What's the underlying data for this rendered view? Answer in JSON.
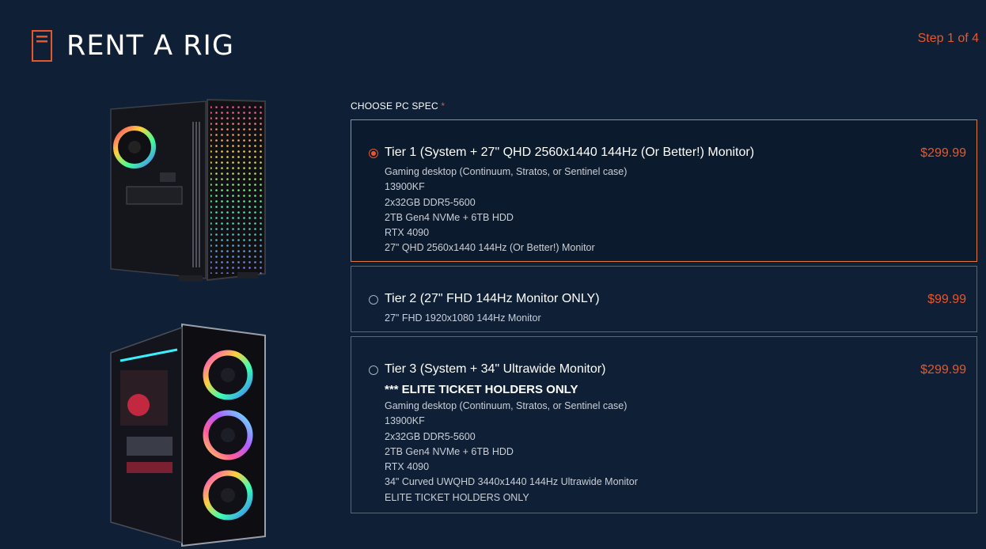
{
  "header": {
    "title": "RENT A RIG",
    "step": "Step 1 of 4"
  },
  "colors": {
    "background": "#0e1f36",
    "accent": "#e8572a",
    "selected_border": "#e07a3c"
  },
  "images": [
    {
      "name": "gaming-pc-tower-infinity-mirror"
    },
    {
      "name": "gaming-pc-tower-rgb-fans"
    }
  ],
  "spec": {
    "label": "CHOOSE PC SPEC",
    "required_mark": "*",
    "options": [
      {
        "title": "Tier 1 (System + 27\" QHD 2560x1440 144Hz (Or Better!) Monitor)",
        "price": "$299.99",
        "selected": true,
        "details": [
          "Gaming desktop (Continuum, Stratos, or Sentinel case)",
          "13900KF",
          "2x32GB DDR5-5600",
          "2TB Gen4 NVMe + 6TB HDD",
          "RTX 4090",
          "27\" QHD 2560x1440 144Hz (Or Better!) Monitor"
        ]
      },
      {
        "title": "Tier 2 (27\" FHD 144Hz Monitor ONLY)",
        "price": "$99.99",
        "selected": false,
        "details": [
          "27\" FHD 1920x1080 144Hz Monitor"
        ]
      },
      {
        "title": "Tier 3 (System + 34\" Ultrawide Monitor)",
        "subtitle": "*** ELITE TICKET HOLDERS ONLY",
        "price": "$299.99",
        "selected": false,
        "details": [
          "Gaming desktop (Continuum, Stratos, or Sentinel case)",
          "13900KF",
          "2x32GB DDR5-5600",
          "2TB Gen4 NVMe + 6TB HDD",
          "RTX 4090",
          "34\" Curved UWQHD 3440x1440 144Hz Ultrawide Monitor",
          "ELITE TICKET HOLDERS ONLY"
        ]
      }
    ]
  }
}
